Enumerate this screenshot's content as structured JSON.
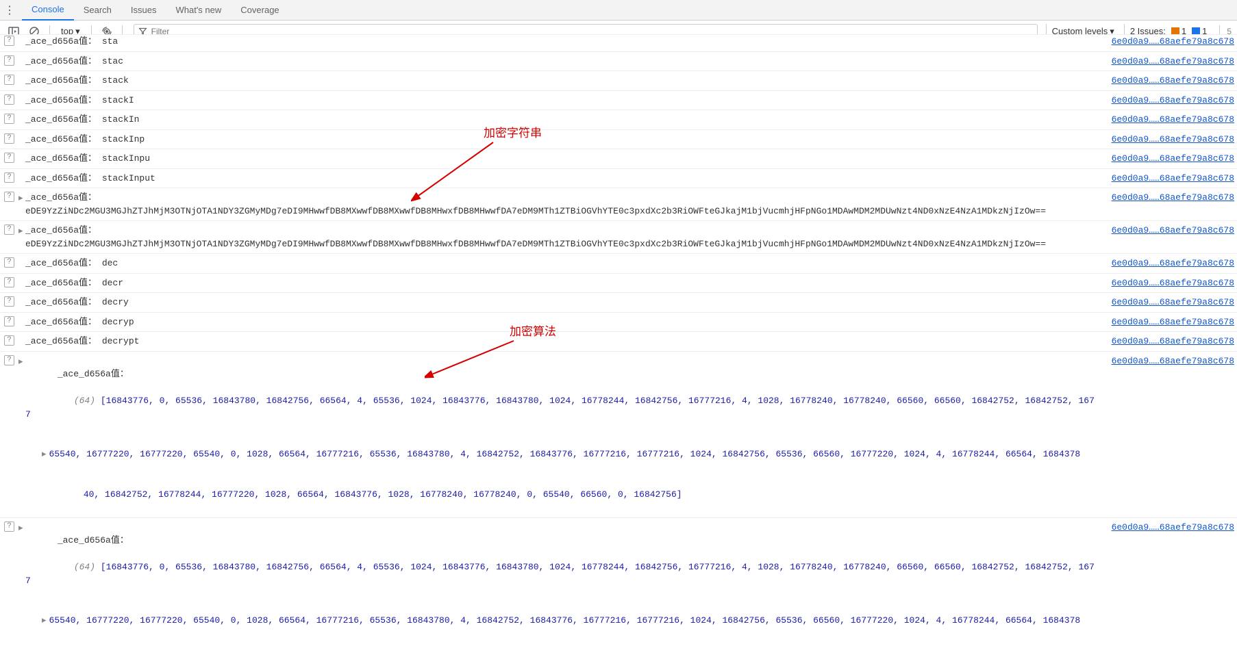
{
  "tabs": {
    "console": "Console",
    "search": "Search",
    "issues": "Issues",
    "whatsnew": "What's new",
    "coverage": "Coverage"
  },
  "toolbar": {
    "context": "top",
    "filter_placeholder": "Filter",
    "levels": "Custom levels",
    "issues_label": "2 Issues:",
    "error_count": "1",
    "info_count": "1",
    "hidden_count": "5"
  },
  "source_link": "6e0d0a9……68aefe79a8c678",
  "prefix": "_ace_d656a值：",
  "encrypted_string": "eDE9YzZiNDc2MGU3MGJhZTJhMjM3OTNjOTA1NDY3ZGMyMDg7eDI9MHwwfDB8MXwwfDB8MXwwfDB8MHwxfDB8MHwwfDA7eDM9MTh1ZTBiOGVhYTE0c3pxdXc2b3RiOWFteGJkajM1bjVucmhjHFpNGo1MDAwMDM2MDUwNzt4ND0xNzE4NzA1MDkzNjIzOw==",
  "rows": [
    {
      "val": "sta"
    },
    {
      "val": "stac"
    },
    {
      "val": "stack"
    },
    {
      "val": "stackI"
    },
    {
      "val": "stackIn"
    },
    {
      "val": "stackInp"
    },
    {
      "val": "stackInpu"
    },
    {
      "val": "stackInput"
    }
  ],
  "rows2": [
    {
      "val": "dec"
    },
    {
      "val": "decr"
    },
    {
      "val": "decry"
    },
    {
      "val": "decryp"
    },
    {
      "val": "decrypt"
    }
  ],
  "array_label": "(64)",
  "array_line1": "[16843776, 0, 65536, 16843780, 16842756, 66564, 4, 65536, 1024, 16843776, 16843780, 1024, 16778244, 16842756, 16777216, 4, 1028, 16778240, 16778240, 66560, 66560, 16842752, 16842752, 1677",
  "array_line2": "65540, 16777220, 16777220, 65540, 0, 1028, 66564, 16777216, 65536, 16843780, 4, 16842752, 16843776, 16777216, 16777216, 1024, 16842756, 65536, 66560, 16777220, 1024, 4, 16778244, 66564, 1684378",
  "array_line3": "40, 16842752, 16778244, 16777220, 1028, 66564, 16843776, 1028, 16778240, 16778240, 0, 65540, 66560, 0, 16842756]",
  "annotations": {
    "enc_label": "加密字符串",
    "alg_label": "加密算法"
  }
}
